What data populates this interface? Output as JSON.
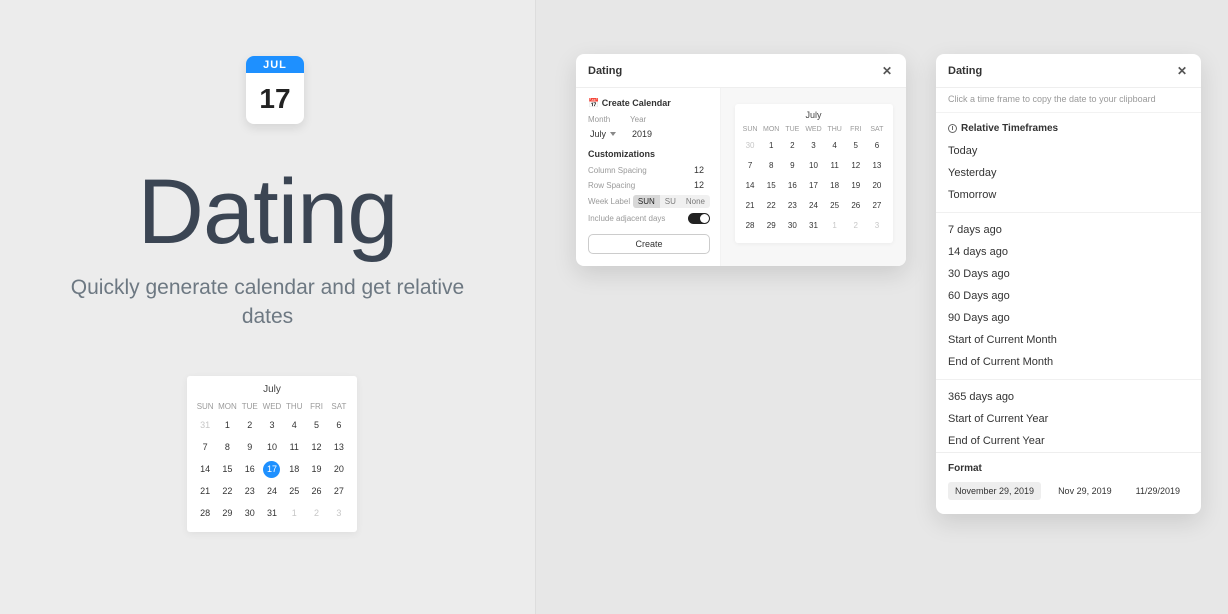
{
  "hero": {
    "icon_month": "JUL",
    "icon_day": "17",
    "title": "Dating",
    "subtitle": "Quickly generate calendar and get relative dates"
  },
  "preview_cal": {
    "month": "July",
    "dow": [
      "SUN",
      "MON",
      "TUE",
      "WED",
      "THU",
      "FRI",
      "SAT"
    ],
    "grid": [
      [
        {
          "d": "31",
          "dim": true
        },
        {
          "d": "1"
        },
        {
          "d": "2"
        },
        {
          "d": "3"
        },
        {
          "d": "4"
        },
        {
          "d": "5"
        },
        {
          "d": "6"
        }
      ],
      [
        {
          "d": "7"
        },
        {
          "d": "8"
        },
        {
          "d": "9"
        },
        {
          "d": "10"
        },
        {
          "d": "11"
        },
        {
          "d": "12"
        },
        {
          "d": "13"
        }
      ],
      [
        {
          "d": "14"
        },
        {
          "d": "15"
        },
        {
          "d": "16"
        },
        {
          "d": "17",
          "selected": true
        },
        {
          "d": "18"
        },
        {
          "d": "19"
        },
        {
          "d": "20"
        }
      ],
      [
        {
          "d": "21"
        },
        {
          "d": "22"
        },
        {
          "d": "23"
        },
        {
          "d": "24"
        },
        {
          "d": "25"
        },
        {
          "d": "26"
        },
        {
          "d": "27"
        }
      ],
      [
        {
          "d": "28"
        },
        {
          "d": "29"
        },
        {
          "d": "30"
        },
        {
          "d": "31"
        },
        {
          "d": "1",
          "dim": true
        },
        {
          "d": "2",
          "dim": true
        },
        {
          "d": "3",
          "dim": true
        }
      ]
    ]
  },
  "window_a": {
    "title": "Dating",
    "section_create": "Create Calendar",
    "month_label": "Month",
    "year_label": "Year",
    "month_value": "July",
    "year_value": "2019",
    "section_custom": "Customizations",
    "col_spacing_label": "Column Spacing",
    "col_spacing_value": "12",
    "row_spacing_label": "Row Spacing",
    "row_spacing_value": "12",
    "week_label_label": "Week Label",
    "week_label_options": [
      "SUN",
      "SU",
      "None"
    ],
    "week_label_selected": "SUN",
    "adjacent_label": "Include adjacent days",
    "adjacent_on": true,
    "create_button": "Create",
    "cal": {
      "month": "July",
      "dow": [
        "SUN",
        "MON",
        "TUE",
        "WED",
        "THU",
        "FRI",
        "SAT"
      ],
      "grid": [
        [
          {
            "d": "30",
            "dim": true
          },
          {
            "d": "1"
          },
          {
            "d": "2"
          },
          {
            "d": "3"
          },
          {
            "d": "4"
          },
          {
            "d": "5"
          },
          {
            "d": "6"
          }
        ],
        [
          {
            "d": "7"
          },
          {
            "d": "8"
          },
          {
            "d": "9"
          },
          {
            "d": "10"
          },
          {
            "d": "11"
          },
          {
            "d": "12"
          },
          {
            "d": "13"
          }
        ],
        [
          {
            "d": "14"
          },
          {
            "d": "15"
          },
          {
            "d": "16"
          },
          {
            "d": "17"
          },
          {
            "d": "18"
          },
          {
            "d": "19"
          },
          {
            "d": "20"
          }
        ],
        [
          {
            "d": "21"
          },
          {
            "d": "22"
          },
          {
            "d": "23"
          },
          {
            "d": "24"
          },
          {
            "d": "25"
          },
          {
            "d": "26"
          },
          {
            "d": "27"
          }
        ],
        [
          {
            "d": "28"
          },
          {
            "d": "29"
          },
          {
            "d": "30"
          },
          {
            "d": "31"
          },
          {
            "d": "1",
            "dim": true
          },
          {
            "d": "2",
            "dim": true
          },
          {
            "d": "3",
            "dim": true
          }
        ]
      ]
    }
  },
  "window_b": {
    "title": "Dating",
    "hint": "Click a time frame to copy the date to your clipboard",
    "section_label": "Relative Timeframes",
    "group1": [
      "Today",
      "Yesterday",
      "Tomorrow"
    ],
    "group2": [
      "7 days ago",
      "14 days ago",
      "30 Days ago",
      "60 Days ago",
      "90 Days ago",
      "Start of Current Month",
      "End of Current Month"
    ],
    "group3": [
      "365 days ago",
      "Start of Current Year",
      "End of Current Year"
    ],
    "format_label": "Format",
    "format_options": [
      "November 29, 2019",
      "Nov 29, 2019",
      "11/29/2019"
    ],
    "format_selected": "November 29, 2019"
  }
}
